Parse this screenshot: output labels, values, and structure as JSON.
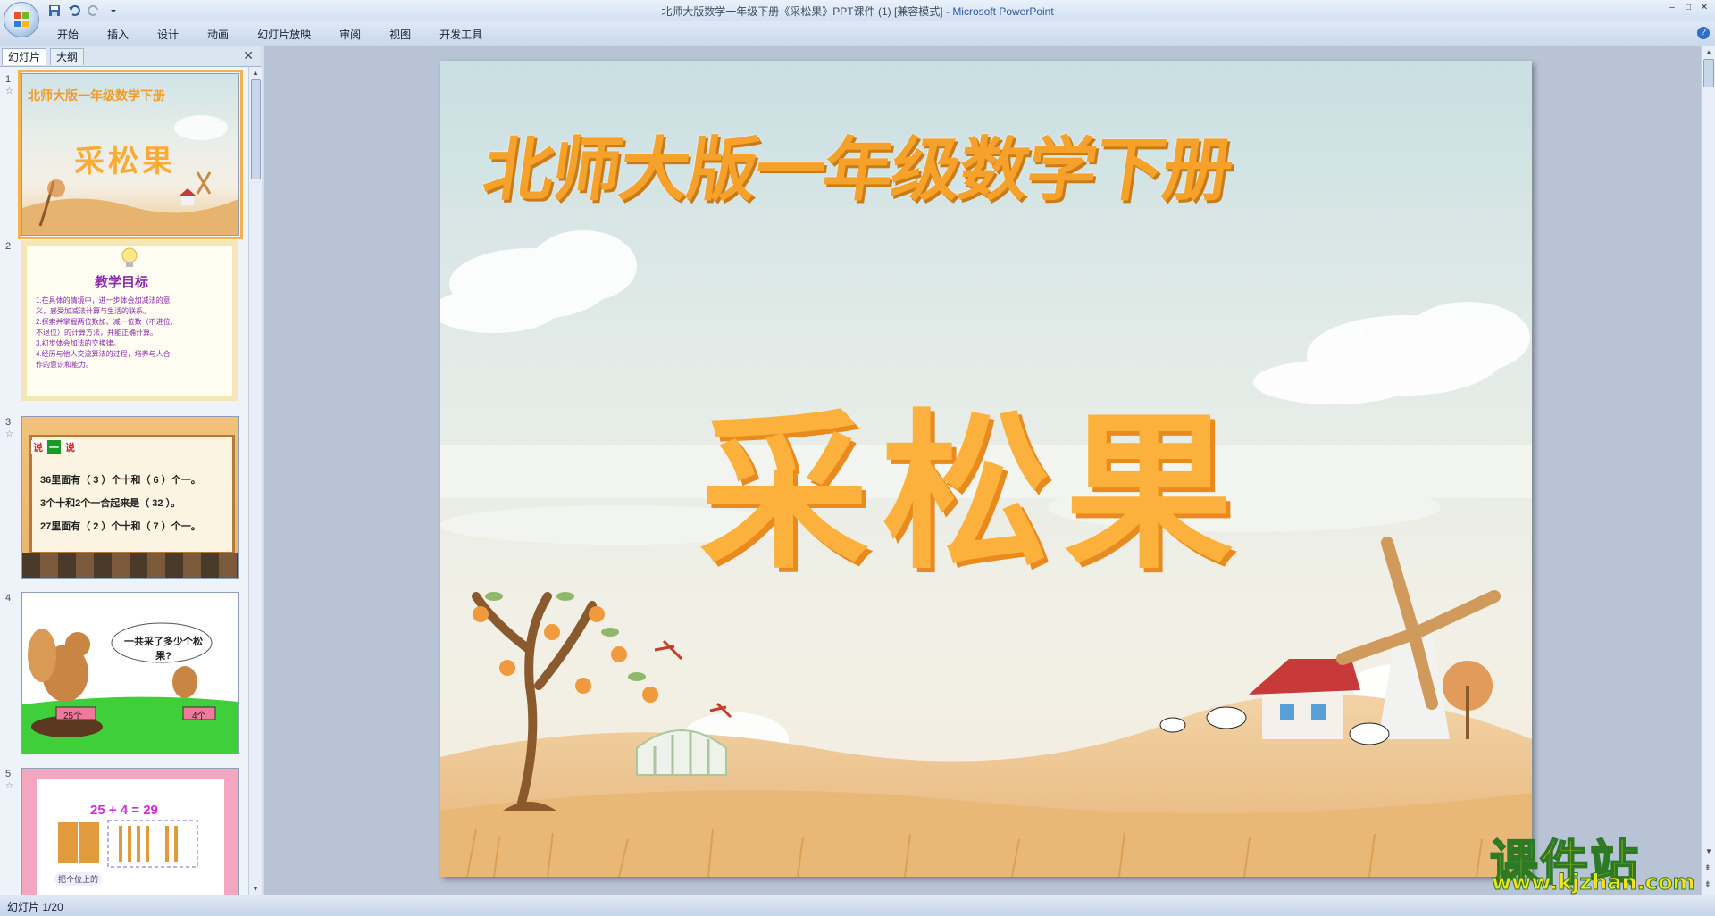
{
  "window": {
    "title": "北师大版数学一年级下册《采松果》PPT课件 (1) [兼容模式]",
    "separator": " - ",
    "app": "Microsoft PowerPoint",
    "controls": [
      "–",
      "□",
      "✕"
    ]
  },
  "ribbon": {
    "tabs": [
      "开始",
      "插入",
      "设计",
      "动画",
      "幻灯片放映",
      "审阅",
      "视图",
      "开发工具"
    ]
  },
  "pane": {
    "tab_slides": "幻灯片",
    "tab_outline": "大纲",
    "close": "✕"
  },
  "thumbnails": [
    {
      "num": "1",
      "star": "☆",
      "title": "北师大版一年级数学下册",
      "main": "采松果"
    },
    {
      "num": "2",
      "star": "",
      "title": "教学目标",
      "lines": [
        "1.在具体的情境中，进一步体会加减法的意",
        "义，感受加减法计算与生活的联系。",
        "2.探索并掌握两位数加、减一位数（不进位、",
        "不退位）的计算方法，并能正确计算。",
        "3.初步体会加法的交换律。",
        "4.经历与他人交流算法的过程，培养与人合",
        "作的意识和能力。"
      ]
    },
    {
      "num": "3",
      "star": "☆",
      "badge": [
        "说",
        "一",
        "说"
      ],
      "lines": [
        "36里面有（ 3 ）个十和（ 6 ）个一。",
        "3个十和2个一合起来是（ 32 ）。",
        "27里面有（ 2 ）个十和（ 7 ）个一。"
      ]
    },
    {
      "num": "4",
      "star": "",
      "bubble": "一共采了多少个松果?",
      "left_sign": "25个",
      "right_sign": "4个"
    },
    {
      "num": "5",
      "star": "☆",
      "equation": "25 + 4 = 29",
      "note": "把个位上的"
    }
  ],
  "slide": {
    "top_title": "北师大版一年级数学下册",
    "main_title": "采松果"
  },
  "watermark": {
    "title": "课件站",
    "url": "www.kjzhan.com"
  },
  "status": {
    "slide_info": "幻灯片 1/20"
  }
}
